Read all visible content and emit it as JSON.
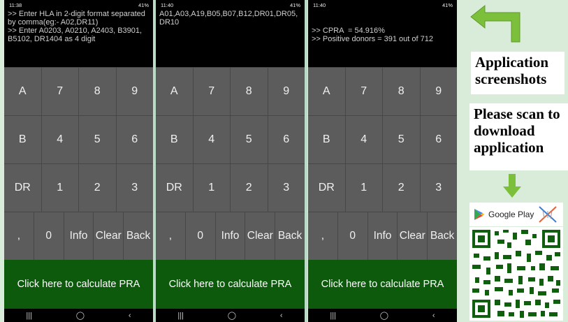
{
  "phones": [
    {
      "status_time": "11:38",
      "status_right": "41%",
      "screen_text": ">> Enter HLA in 2-digit format separated by comma(eg:- A02,DR11)\n>> Enter A0203, A0210, A2403, B3901, B5102, DR1404 as 4 digit"
    },
    {
      "status_time": "11:40",
      "status_right": "41%",
      "screen_text": "A01,A03,A19,B05,B07,B12,DR01,DR05,\nDR10"
    },
    {
      "status_time": "11:40",
      "status_right": "41%",
      "screen_text": "\n\n>> CPRA  = 54.916%\n>> Positive donors = 391 out of 712"
    }
  ],
  "keypad": {
    "row1": [
      "A",
      "7",
      "8",
      "9"
    ],
    "row2": [
      "B",
      "4",
      "5",
      "6"
    ],
    "row3": [
      "DR",
      "1",
      "2",
      "3"
    ],
    "row4": [
      ",",
      "0",
      "Info",
      "Clear",
      "Back"
    ]
  },
  "calc_button_label": "Click here to calculate PRA",
  "nav_icons": [
    "recent-apps-icon",
    "home-icon",
    "back-icon"
  ],
  "right_panel": {
    "label1": "Application screenshots",
    "label2": "Please scan to download application",
    "store_label": "Google Play",
    "arrow_color": "#7bbf3a"
  },
  "colors": {
    "keypad_bg": "#5c5c5c",
    "calc_bg": "#0d5a0d",
    "panel_bg": "#d9ecd9"
  }
}
